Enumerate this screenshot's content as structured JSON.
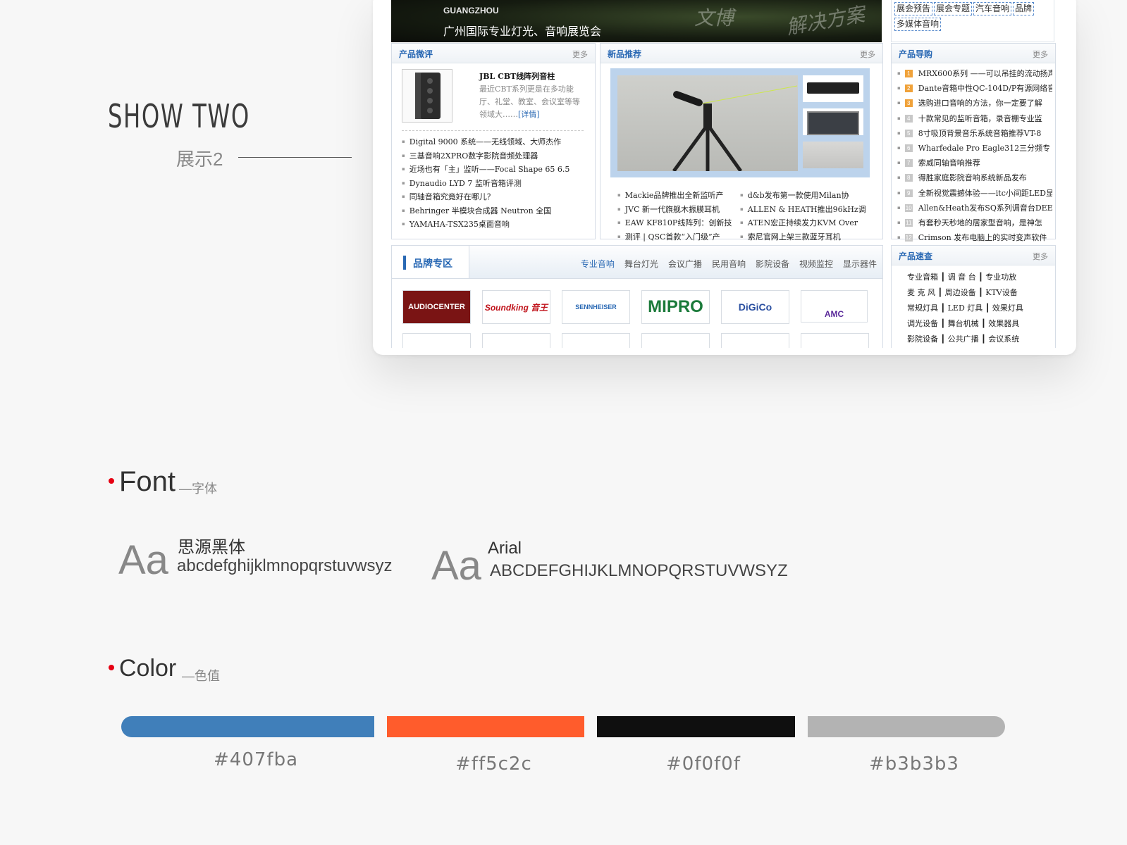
{
  "show": {
    "title": "SHOW TWO",
    "subtitle": "展示2"
  },
  "site": {
    "banner": {
      "city": "GUANGZHOU",
      "expo": "广州国际专业灯光、音响展览会",
      "watermark1": "文博",
      "watermark2": "解决方案"
    },
    "tags": [
      "展会预告",
      "展会专题",
      "汽车音响",
      "品牌",
      "多媒体音响"
    ],
    "review": {
      "title": "产品微评",
      "more": "更多",
      "feature_title": "JBL CBT线阵列音柱",
      "feature_desc": "最近CBT系列更是在多功能厅、礼堂、教室、会议室等等领域大……",
      "feature_link": "[详情]",
      "items": [
        "Digital 9000 系统——无线领域、大师杰作",
        "三基音响2XPRO数字影院音频处理器",
        "近场也有「主」监听——Focal Shape 65 6.5",
        "Dynaudio LYD 7 监听音箱评测",
        "同轴音箱究竟好在哪儿？",
        "Behringer 半模块合成器 Neutron 全国",
        "YAMAHA-TSX235桌面音响"
      ]
    },
    "new_products": {
      "title": "新品推荐",
      "more": "更多",
      "items_left": [
        "Mackie品牌推出全新监听产",
        "JVC 新一代旗舰木振膜耳机",
        "EAW KF810P线阵列：创新技",
        "测评 | QSC首款“入门级”产"
      ],
      "items_right": [
        "d&b发布第一款使用Milan协",
        "ALLEN & HEATH推出96kHz调",
        "ATEN宏正持续发力KVM Over",
        "索尼官网上架三款蓝牙耳机"
      ]
    },
    "guide": {
      "title": "产品导购",
      "more": "更多",
      "items": [
        {
          "n": "1",
          "text": "MRX600系列 ——可以吊挂的流动扬声"
        },
        {
          "n": "2",
          "text": "Dante音箱中性QC-104D/P有源网络音"
        },
        {
          "n": "3",
          "text": "选购进口音响的方法，你一定要了解"
        },
        {
          "n": "4",
          "text": "十款常见的监听音箱，录音棚专业监"
        },
        {
          "n": "5",
          "text": "8寸吸顶背景音乐系统音箱推荐VT-8"
        },
        {
          "n": "6",
          "text": "Wharfedale Pro Eagle312三分频专"
        },
        {
          "n": "7",
          "text": "索威同轴音响推荐"
        },
        {
          "n": "8",
          "text": "得胜家庭影院音响系统新品发布"
        },
        {
          "n": "9",
          "text": "全新视觉震撼体验——itc小间距LED显"
        },
        {
          "n": "10",
          "text": "Allen&Heath发布SQ系列调音台DEEP"
        },
        {
          "n": "11",
          "text": "有套秒天秒地的居家型音响，是神怎"
        },
        {
          "n": "12",
          "text": "Crimson 发布电脑上的实时变声软件"
        }
      ]
    },
    "brand": {
      "title": "品牌专区",
      "tabs": [
        "专业音响",
        "舞台灯光",
        "会议广播",
        "民用音响",
        "影院设备",
        "视频监控",
        "显示器件"
      ],
      "logos": [
        "AUDIOCENTER",
        "Soundking 音王",
        "SENNHEISER",
        "MIPRO",
        "DiGiCo",
        "AMC"
      ]
    },
    "quick": {
      "title": "产品速查",
      "more": "更多",
      "rows": [
        [
          "专业音箱",
          "调 音 台",
          "专业功放"
        ],
        [
          "麦 克 风",
          "周边设备",
          "KTV设备"
        ],
        [
          "常规灯具",
          "LED 灯具",
          "效果灯具"
        ],
        [
          "调光设备",
          "舞台机械",
          "效果器具"
        ],
        [
          "影院设备",
          "公共广播",
          "会议系统"
        ]
      ]
    }
  },
  "font": {
    "title": "Font",
    "subtitle": "—字体",
    "aa": "Aa",
    "f1_name": "思源黑体",
    "f1_sample": "abcdefghijklmnopqrstuvwsyz",
    "f2_name": "Arial",
    "f2_sample": "ABCDEFGHIJKLMNOPQRSTUVWSYZ"
  },
  "color": {
    "title": "Color",
    "subtitle": "—色值",
    "swatches": [
      {
        "hex": "#407fba",
        "label": "#407fba"
      },
      {
        "hex": "#ff5c2c",
        "label": "#ff5c2c"
      },
      {
        "hex": "#0f0f0f",
        "label": "#0f0f0f"
      },
      {
        "hex": "#b3b3b3",
        "label": "#b3b3b3"
      }
    ]
  }
}
